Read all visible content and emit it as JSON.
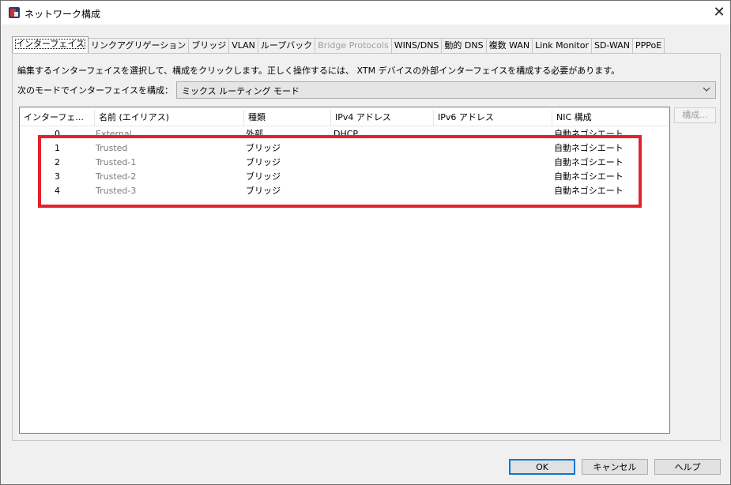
{
  "window": {
    "title": "ネットワーク構成"
  },
  "tabs": [
    {
      "label": "インターフェイス",
      "active": true,
      "disabled": false
    },
    {
      "label": "リンクアグリゲーション",
      "active": false,
      "disabled": false
    },
    {
      "label": "ブリッジ",
      "active": false,
      "disabled": false
    },
    {
      "label": "VLAN",
      "active": false,
      "disabled": false
    },
    {
      "label": "ループバック",
      "active": false,
      "disabled": false
    },
    {
      "label": "Bridge Protocols",
      "active": false,
      "disabled": true
    },
    {
      "label": "WINS/DNS",
      "active": false,
      "disabled": false
    },
    {
      "label": "動的 DNS",
      "active": false,
      "disabled": false
    },
    {
      "label": "複数 WAN",
      "active": false,
      "disabled": false
    },
    {
      "label": "Link Monitor",
      "active": false,
      "disabled": false
    },
    {
      "label": "SD-WAN",
      "active": false,
      "disabled": false
    },
    {
      "label": "PPPoE",
      "active": false,
      "disabled": false
    }
  ],
  "panel": {
    "description": "編集するインターフェイスを選択して、構成をクリックします。正しく操作するには、 XTM デバイスの外部インターフェイスを構成する必要があります。",
    "mode_label": "次のモードでインターフェイスを構成：",
    "mode_value": "ミックス ルーティング モード"
  },
  "table": {
    "columns": [
      "インターフェ...",
      "名前 (エイリアス)",
      "種類",
      "IPv4 アドレス",
      "IPv6 アドレス",
      "NIC 構成"
    ],
    "rows": [
      {
        "iface": "0",
        "name": "External",
        "type": "外部",
        "ipv4": "DHCP",
        "ipv6": "",
        "nic": "自動ネゴシエート"
      },
      {
        "iface": "1",
        "name": "Trusted",
        "type": "ブリッジ",
        "ipv4": "",
        "ipv6": "",
        "nic": "自動ネゴシエート"
      },
      {
        "iface": "2",
        "name": "Trusted-1",
        "type": "ブリッジ",
        "ipv4": "",
        "ipv6": "",
        "nic": "自動ネゴシエート"
      },
      {
        "iface": "3",
        "name": "Trusted-2",
        "type": "ブリッジ",
        "ipv4": "",
        "ipv6": "",
        "nic": "自動ネゴシエート"
      },
      {
        "iface": "4",
        "name": "Trusted-3",
        "type": "ブリッジ",
        "ipv4": "",
        "ipv6": "",
        "nic": "自動ネゴシエート"
      }
    ]
  },
  "side": {
    "configure_label": "構成..."
  },
  "footer": {
    "ok_label": "OK",
    "cancel_label": "キャンセル",
    "help_label": "ヘルプ"
  },
  "annotation": {
    "highlight_color": "#e3232b"
  }
}
